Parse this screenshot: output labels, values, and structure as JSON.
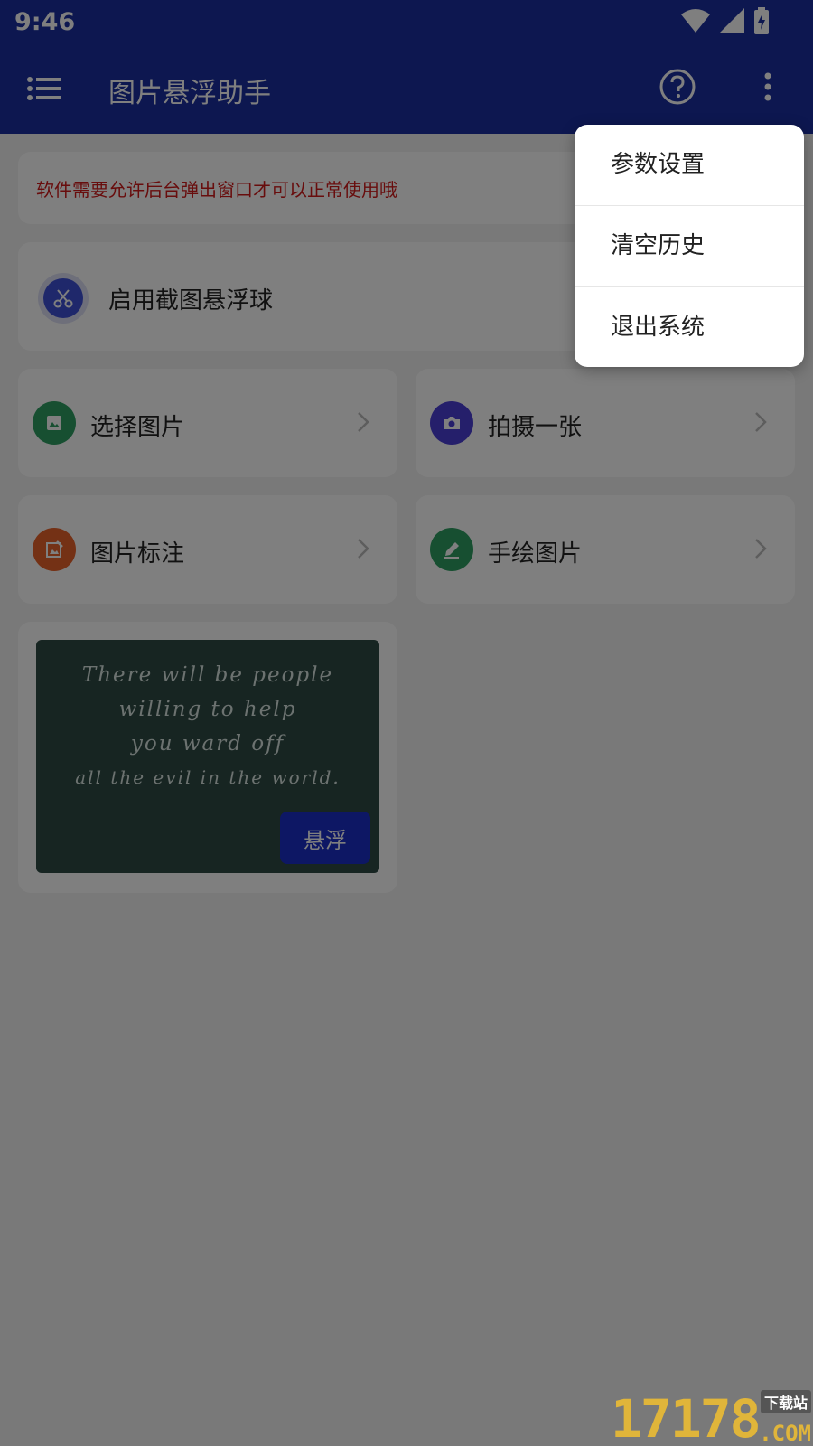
{
  "status_bar": {
    "time": "9:46"
  },
  "app_bar": {
    "title": "图片悬浮助手",
    "icons": [
      "menu-icon",
      "help-icon",
      "more-vert-icon"
    ]
  },
  "notice": {
    "text": "软件需要允许后台弹出窗口才可以正常使用哦"
  },
  "toggle": {
    "label": "启用截图悬浮球",
    "icon": "scissors-icon"
  },
  "tiles": [
    {
      "label": "选择图片",
      "icon": "image-icon",
      "color": "#2e9e63"
    },
    {
      "label": "拍摄一张",
      "icon": "camera-icon",
      "color": "#4b3fd6"
    },
    {
      "label": "图片标注",
      "icon": "edit-image-icon",
      "color": "#e8622a"
    },
    {
      "label": "手绘图片",
      "icon": "pencil-icon",
      "color": "#2e9e63"
    }
  ],
  "image_card": {
    "lines": [
      "There will be people",
      "willing to help",
      "you ward off",
      "all the evil in the world."
    ],
    "float_button": "悬浮"
  },
  "popup_menu": {
    "items": [
      "参数设置",
      "清空历史",
      "退出系统"
    ]
  },
  "watermark": {
    "digits": "17178",
    "tag": "下载站",
    "com": ".COM"
  },
  "colors": {
    "primary": "#1a2fa0",
    "notice_text": "#d11a1a",
    "accent_button": "#1a2fc8"
  }
}
